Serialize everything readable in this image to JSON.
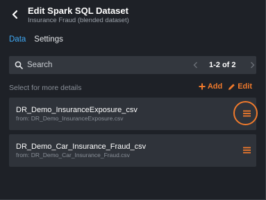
{
  "header": {
    "title": "Edit Spark SQL Dataset",
    "subtitle": "Insurance Fraud (blended dataset)"
  },
  "tabs": [
    {
      "label": "Data",
      "active": true
    },
    {
      "label": "Settings",
      "active": false
    }
  ],
  "search": {
    "placeholder": "Search",
    "value": ""
  },
  "pager": {
    "text": "1-2 of 2"
  },
  "list": {
    "hint": "Select for more details",
    "add_label": "Add",
    "edit_label": "Edit",
    "items": [
      {
        "name": "DR_Demo_InsuranceExposure_csv",
        "from": "from: DR_Demo_InsuranceExposure.csv",
        "highlighted": true
      },
      {
        "name": "DR_Demo_Car_Insurance_Fraud_csv",
        "from": "from: DR_Demo_Car_Insurance_Fraud.csv",
        "highlighted": false
      }
    ]
  },
  "colors": {
    "background": "#1e2127",
    "card": "#2f333a",
    "accent_blue": "#3fa9f5",
    "accent_orange": "#f07a2c"
  },
  "icons": {
    "back": "chevron-left-icon",
    "search": "search-icon",
    "prev": "chevron-left-icon",
    "next": "chevron-right-icon",
    "add": "plus-icon",
    "edit": "pencil-icon",
    "menu": "hamburger-menu-icon"
  }
}
